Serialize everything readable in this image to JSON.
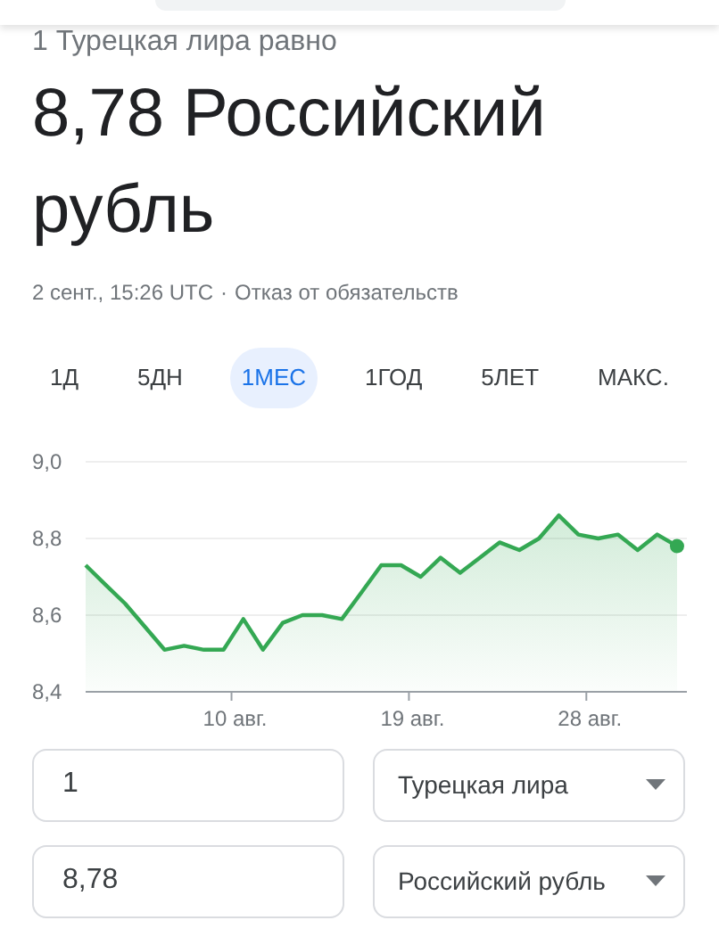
{
  "header": {
    "subtitle": "1 Турецкая лира равно",
    "result": "8,78 Российский рубль",
    "timestamp": "2 сент., 15:26 UTC",
    "separator": "·",
    "disclaimer": "Отказ от обязательств"
  },
  "tabs": [
    {
      "label": "1Д",
      "selected": false
    },
    {
      "label": "5ДН",
      "selected": false
    },
    {
      "label": "1МЕС",
      "selected": true
    },
    {
      "label": "1ГОД",
      "selected": false
    },
    {
      "label": "5ЛЕТ",
      "selected": false
    },
    {
      "label": "МАКС.",
      "selected": false
    }
  ],
  "chart": {
    "chart_data": {
      "type": "area",
      "x": [
        2.6,
        3.6,
        4.6,
        5.6,
        6.6,
        7.6,
        8.6,
        9.6,
        10.6,
        11.6,
        12.6,
        13.6,
        14.6,
        15.6,
        16.6,
        17.6,
        18.6,
        19.6,
        20.6,
        21.6,
        22.6,
        23.6,
        24.6,
        25.6,
        26.6,
        27.6,
        28.6,
        29.6,
        30.6,
        31.6,
        32.6
      ],
      "series": [
        {
          "color": "#34a853",
          "values": [
            8.73,
            8.68,
            8.63,
            8.57,
            8.51,
            8.52,
            8.51,
            8.51,
            8.59,
            8.51,
            8.58,
            8.6,
            8.6,
            8.59,
            8.66,
            8.73,
            8.73,
            8.7,
            8.75,
            8.71,
            8.75,
            8.79,
            8.77,
            8.8,
            8.86,
            8.81,
            8.8,
            8.81,
            8.77,
            8.81,
            8.78
          ]
        }
      ],
      "xlim": [
        2.6,
        33.1
      ],
      "ylim": [
        8.4,
        9.0
      ],
      "yticks": [
        {
          "value": 8.4,
          "label": "8,4"
        },
        {
          "value": 8.6,
          "label": "8,6"
        },
        {
          "value": 8.8,
          "label": "8,8"
        },
        {
          "value": 9.0,
          "label": "9,0"
        }
      ],
      "xticks": [
        {
          "value": 10,
          "label": "10 авг."
        },
        {
          "value": 19,
          "label": "19 авг."
        },
        {
          "value": 28,
          "label": "28 авг."
        }
      ]
    }
  },
  "converter": [
    {
      "amount": "1",
      "currency": "Турецкая лира"
    },
    {
      "amount": "8,78",
      "currency": "Российский рубль"
    }
  ]
}
